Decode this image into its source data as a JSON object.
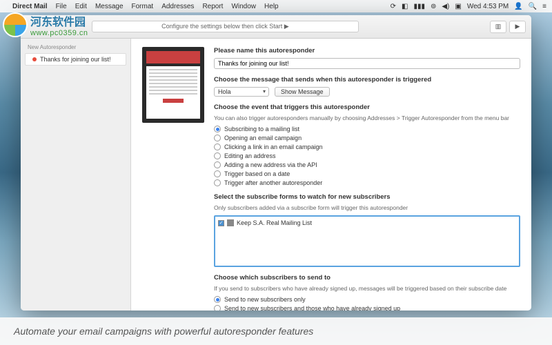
{
  "menubar": {
    "app_name": "Direct Mail",
    "items": [
      "File",
      "Edit",
      "Message",
      "Format",
      "Addresses",
      "Report",
      "Window",
      "Help"
    ],
    "clock": "Wed 4:53 PM"
  },
  "toolbar": {
    "settings_note": "Configure the settings below then click Start ▶"
  },
  "sidebar": {
    "header": "New Autoresponder",
    "items": [
      {
        "label": "Thanks for joining our list!"
      }
    ]
  },
  "form": {
    "name_section": {
      "title": "Please name this autoresponder",
      "value": "Thanks for joining our list!"
    },
    "message_section": {
      "title": "Choose the message that sends when this autoresponder is triggered",
      "select_value": "Hola",
      "show_btn": "Show Message"
    },
    "event_section": {
      "title": "Choose the event that triggers this autoresponder",
      "subtitle": "You can also trigger autoresponders manually by choosing Addresses > Trigger Autoresponder from the menu bar",
      "options": [
        "Subscribing to a mailing list",
        "Opening an email campaign",
        "Clicking a link in an email campaign",
        "Editing an address",
        "Adding a new address via the API",
        "Trigger based on a date",
        "Trigger after another autoresponder"
      ],
      "selected": 0
    },
    "forms_section": {
      "title": "Select the subscribe forms to watch for new subscribers",
      "subtitle": "Only subscribers added via a subscribe form will trigger this autoresponder",
      "list_item": "Keep S.A. Real Mailing List"
    },
    "subscribers_section": {
      "title": "Choose which subscribers to send to",
      "subtitle": "If you send to subscribers who have already signed up, messages will be triggered based on their subscribe date",
      "options": [
        "Send to new subscribers only",
        "Send to new subscribers and those who have already signed up"
      ],
      "selected": 0
    }
  },
  "caption": "Automate your email campaigns with powerful autoresponder features",
  "watermark": {
    "cn": "河东软件园",
    "url": "www.pc0359.cn"
  }
}
